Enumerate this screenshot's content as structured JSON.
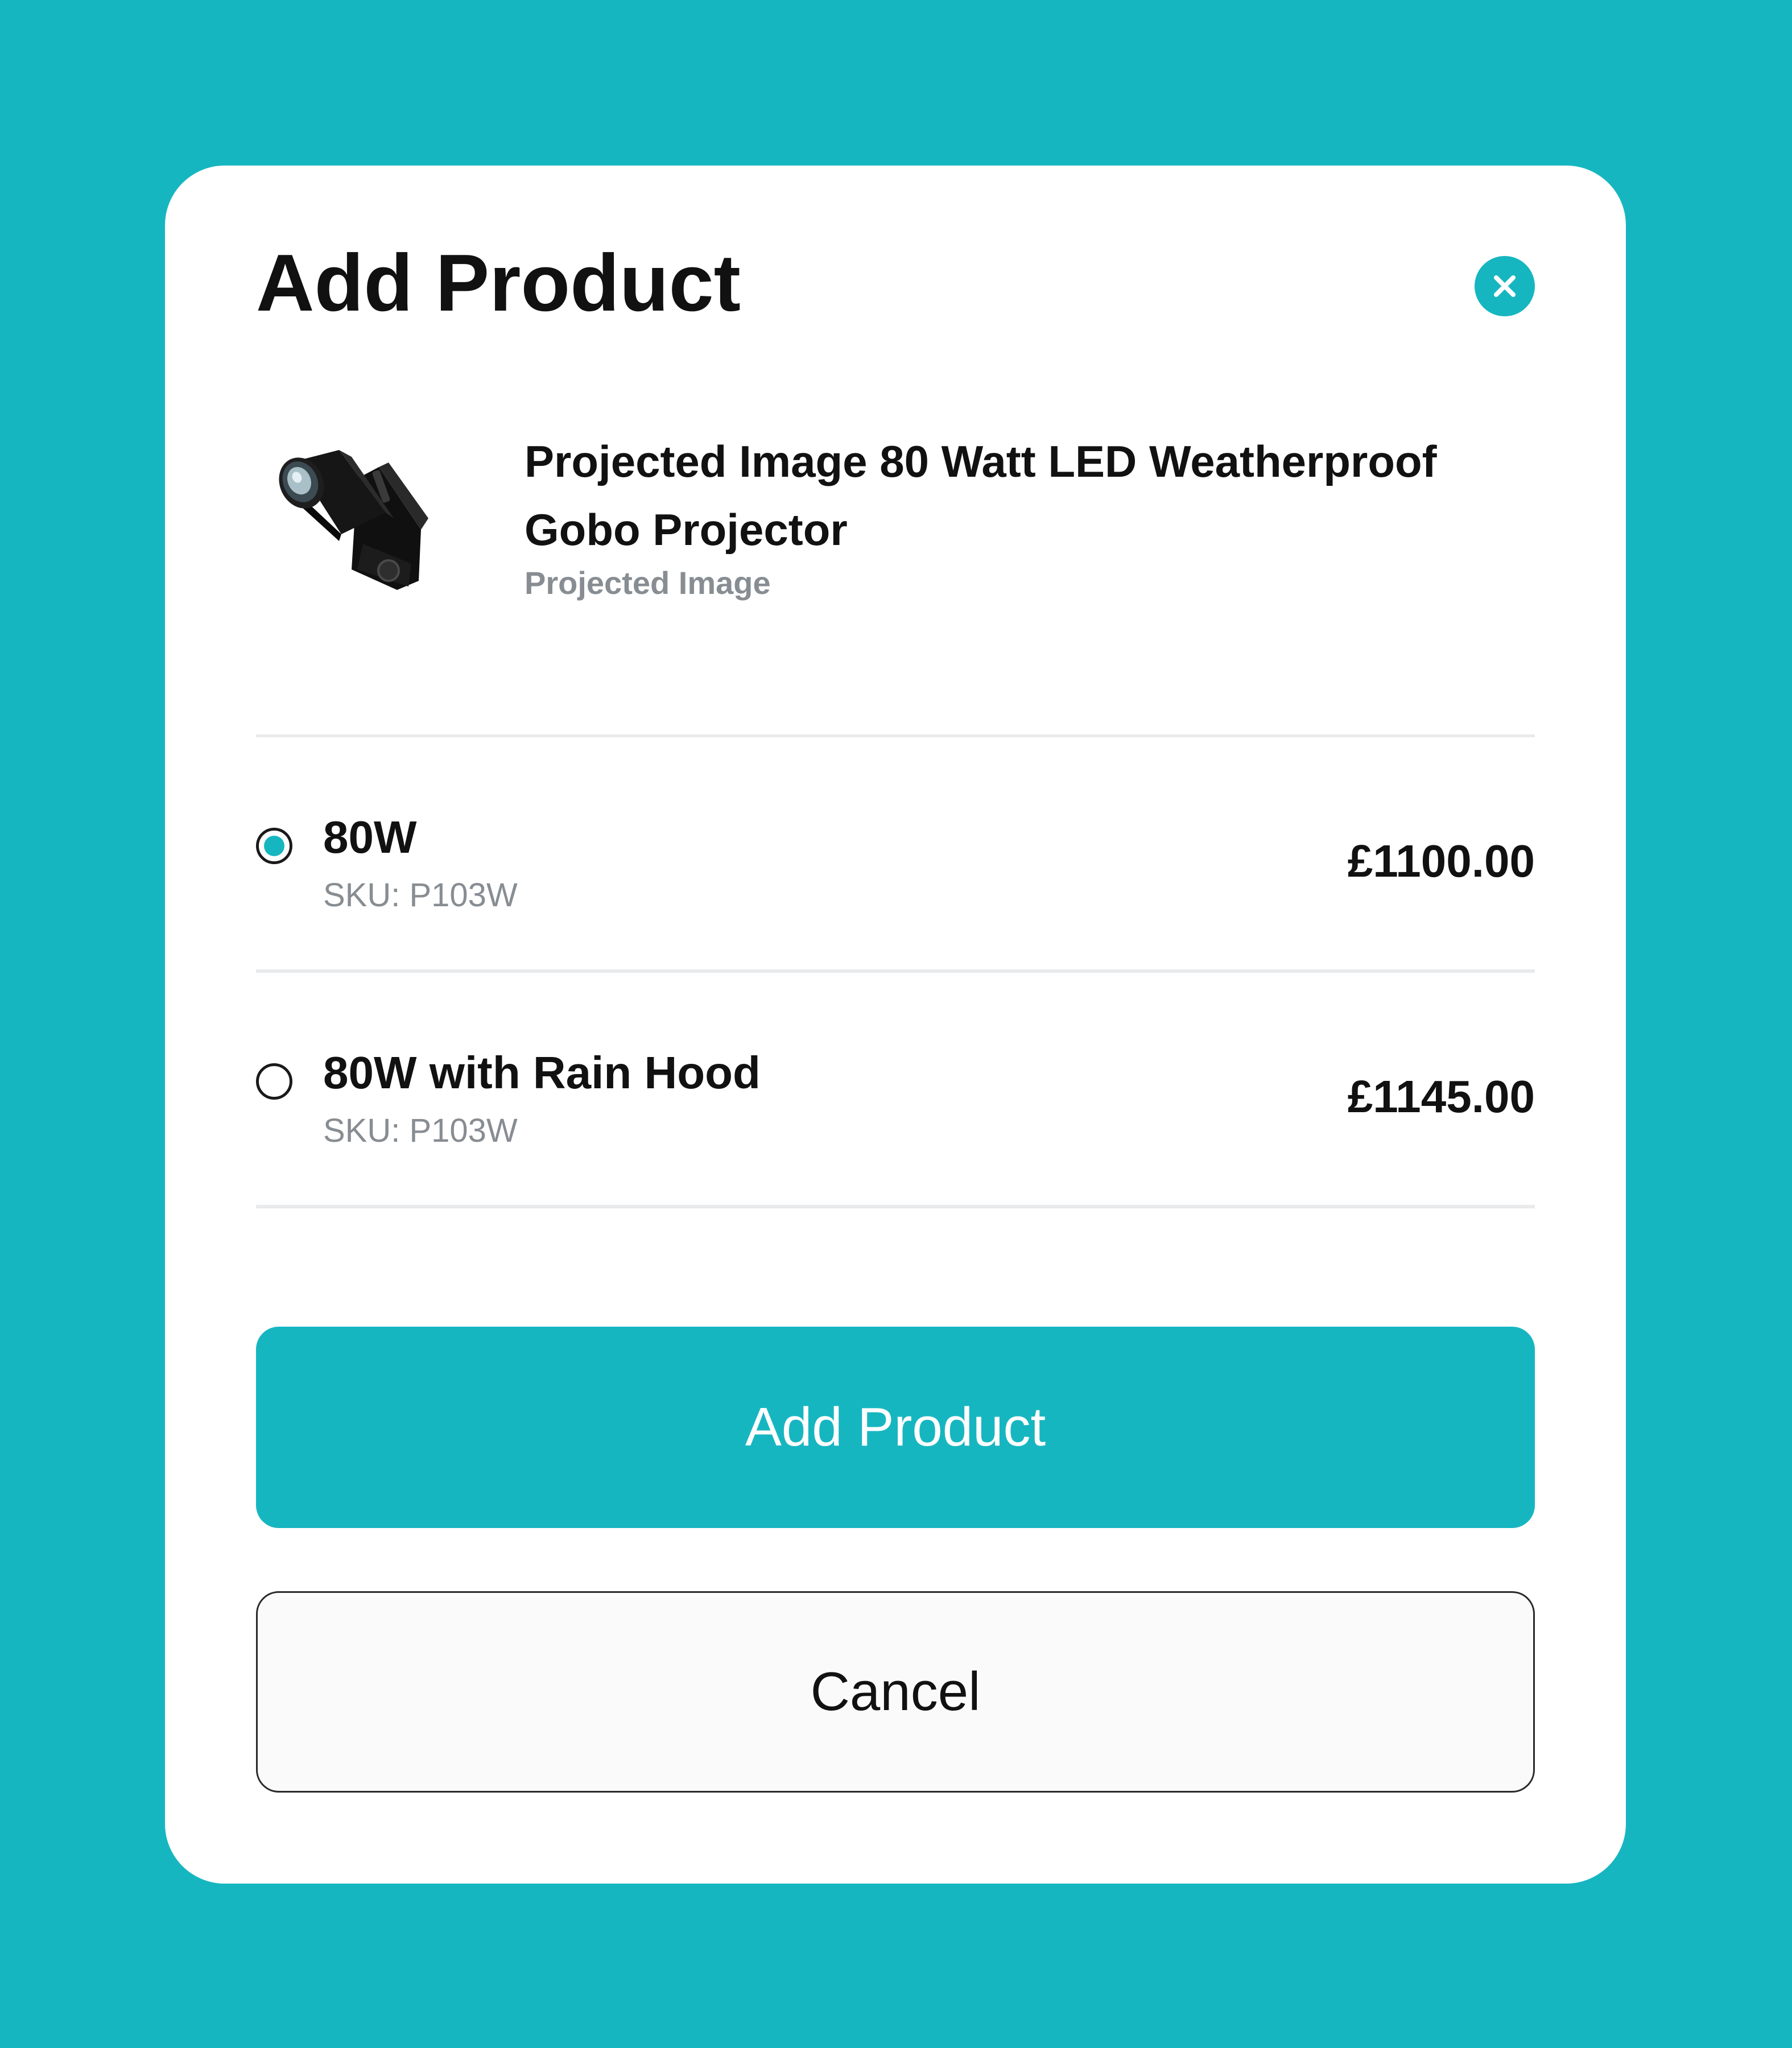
{
  "colors": {
    "background": "#16b6c1",
    "accent": "#16b6c1",
    "surface": "#ffffff",
    "text_primary": "#111111",
    "text_secondary": "#878d92",
    "divider": "#e9eaeb"
  },
  "modal": {
    "title": "Add Product",
    "close_icon": "close-x-icon"
  },
  "product": {
    "name": "Projected Image 80 Watt LED Weatherproof Gobo Projector",
    "brand": "Projected Image",
    "image_icon": "gobo-projector-image"
  },
  "variants": [
    {
      "label": "80W",
      "sku": "SKU: P103W",
      "price": "£1100.00",
      "selected": true
    },
    {
      "label": "80W with Rain Hood",
      "sku": "SKU: P103W",
      "price": "£1145.00",
      "selected": false
    }
  ],
  "actions": {
    "primary_label": "Add Product",
    "secondary_label": "Cancel"
  }
}
